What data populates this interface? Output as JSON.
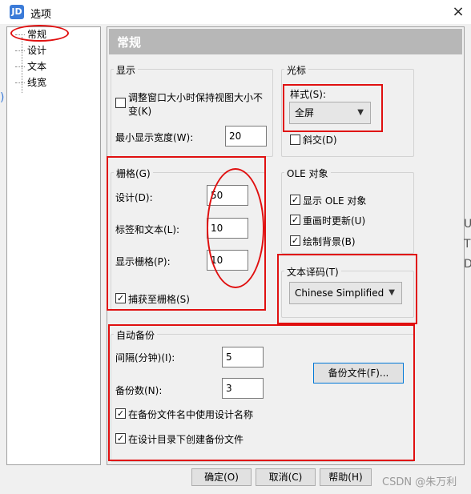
{
  "window": {
    "title": "选项",
    "app_icon_text": "JD",
    "close_glyph": "×"
  },
  "tree": {
    "items": [
      "常规",
      "设计",
      "文本",
      "线宽"
    ]
  },
  "header": {
    "title": "常规"
  },
  "display": {
    "legend": "显示",
    "resize_label": "调整窗口大小时保持视图大小不变(K)",
    "resize_line1": "调整窗口大小时保持视图大小不",
    "resize_line2": "变(K)",
    "min_width_label": "最小显示宽度(W):",
    "min_width_value": "20"
  },
  "cursor": {
    "legend": "光标",
    "style_label": "样式(S):",
    "style_value": "全屏",
    "oblique_label": "斜交(D)"
  },
  "grid": {
    "legend": "栅格(G)",
    "design_label": "设计(D):",
    "design_value": "50",
    "label_text_label": "标签和文本(L):",
    "label_text_value": "10",
    "display_grid_label": "显示栅格(P):",
    "display_grid_value": "10",
    "snap_label": "捕获至栅格(S)"
  },
  "ole": {
    "legend": "OLE 对象",
    "show_label": "显示 OLE 对象",
    "redraw_label": "重画时更新(U)",
    "background_label": "绘制背景(B)"
  },
  "encoding": {
    "legend": "文本译码(T)",
    "value": "Chinese Simplified"
  },
  "backup": {
    "legend": "自动备份",
    "interval_label": "间隔(分钟)(I):",
    "interval_value": "5",
    "count_label": "备份数(N):",
    "count_value": "3",
    "files_button": "备份文件(F)...",
    "use_design_name_label": "在备份文件名中使用设计名称",
    "create_in_dir_label": "在设计目录下创建备份文件"
  },
  "footer": {
    "ok": "确定(O)",
    "cancel": "取消(C)",
    "help": "帮助(H)"
  },
  "watermark": "CSDN @朱万利",
  "side_fragments": {
    "left": ")",
    "right_1": "U",
    "right_2": "T",
    "right_3": "D"
  },
  "colors": {
    "annotation": "#e01010",
    "header_bg": "#b7b7b7"
  }
}
